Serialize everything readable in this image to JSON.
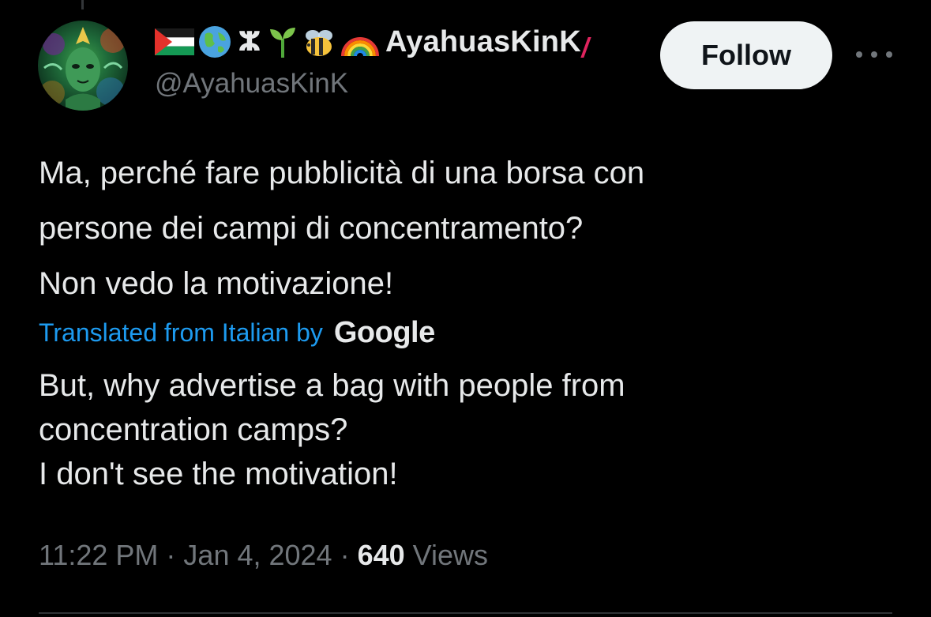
{
  "tweet": {
    "author": {
      "display_name": "AyahuasKinK",
      "handle": "@AyahuasKinK",
      "name_emojis": [
        "palestine-flag-icon",
        "globe-icon",
        "amazigh-symbol-icon",
        "seedling-icon",
        "bee-icon",
        "rainbow-icon"
      ],
      "amazigh_symbol": "ⵣ"
    },
    "follow_label": "Follow",
    "original_lines": [
      "Ma, perché fare pubblicità di una borsa con",
      "persone dei campi di concentramento?",
      "Non vedo la motivazione!"
    ],
    "translation": {
      "label": "Translated from Italian by",
      "provider": "Google",
      "lines": [
        "But, why advertise a bag with people from",
        "concentration camps?",
        "I don't see the motivation!"
      ]
    },
    "meta": {
      "time": "11:22 PM",
      "separator": "·",
      "date": "Jan 4, 2024",
      "views_count": "640",
      "views_label": "Views"
    }
  },
  "colors": {
    "background": "#000000",
    "text_primary": "#e7e9ea",
    "text_secondary": "#71767b",
    "link_blue": "#1d9bf0",
    "follow_bg": "#eff3f4",
    "divider": "#2f3336"
  }
}
